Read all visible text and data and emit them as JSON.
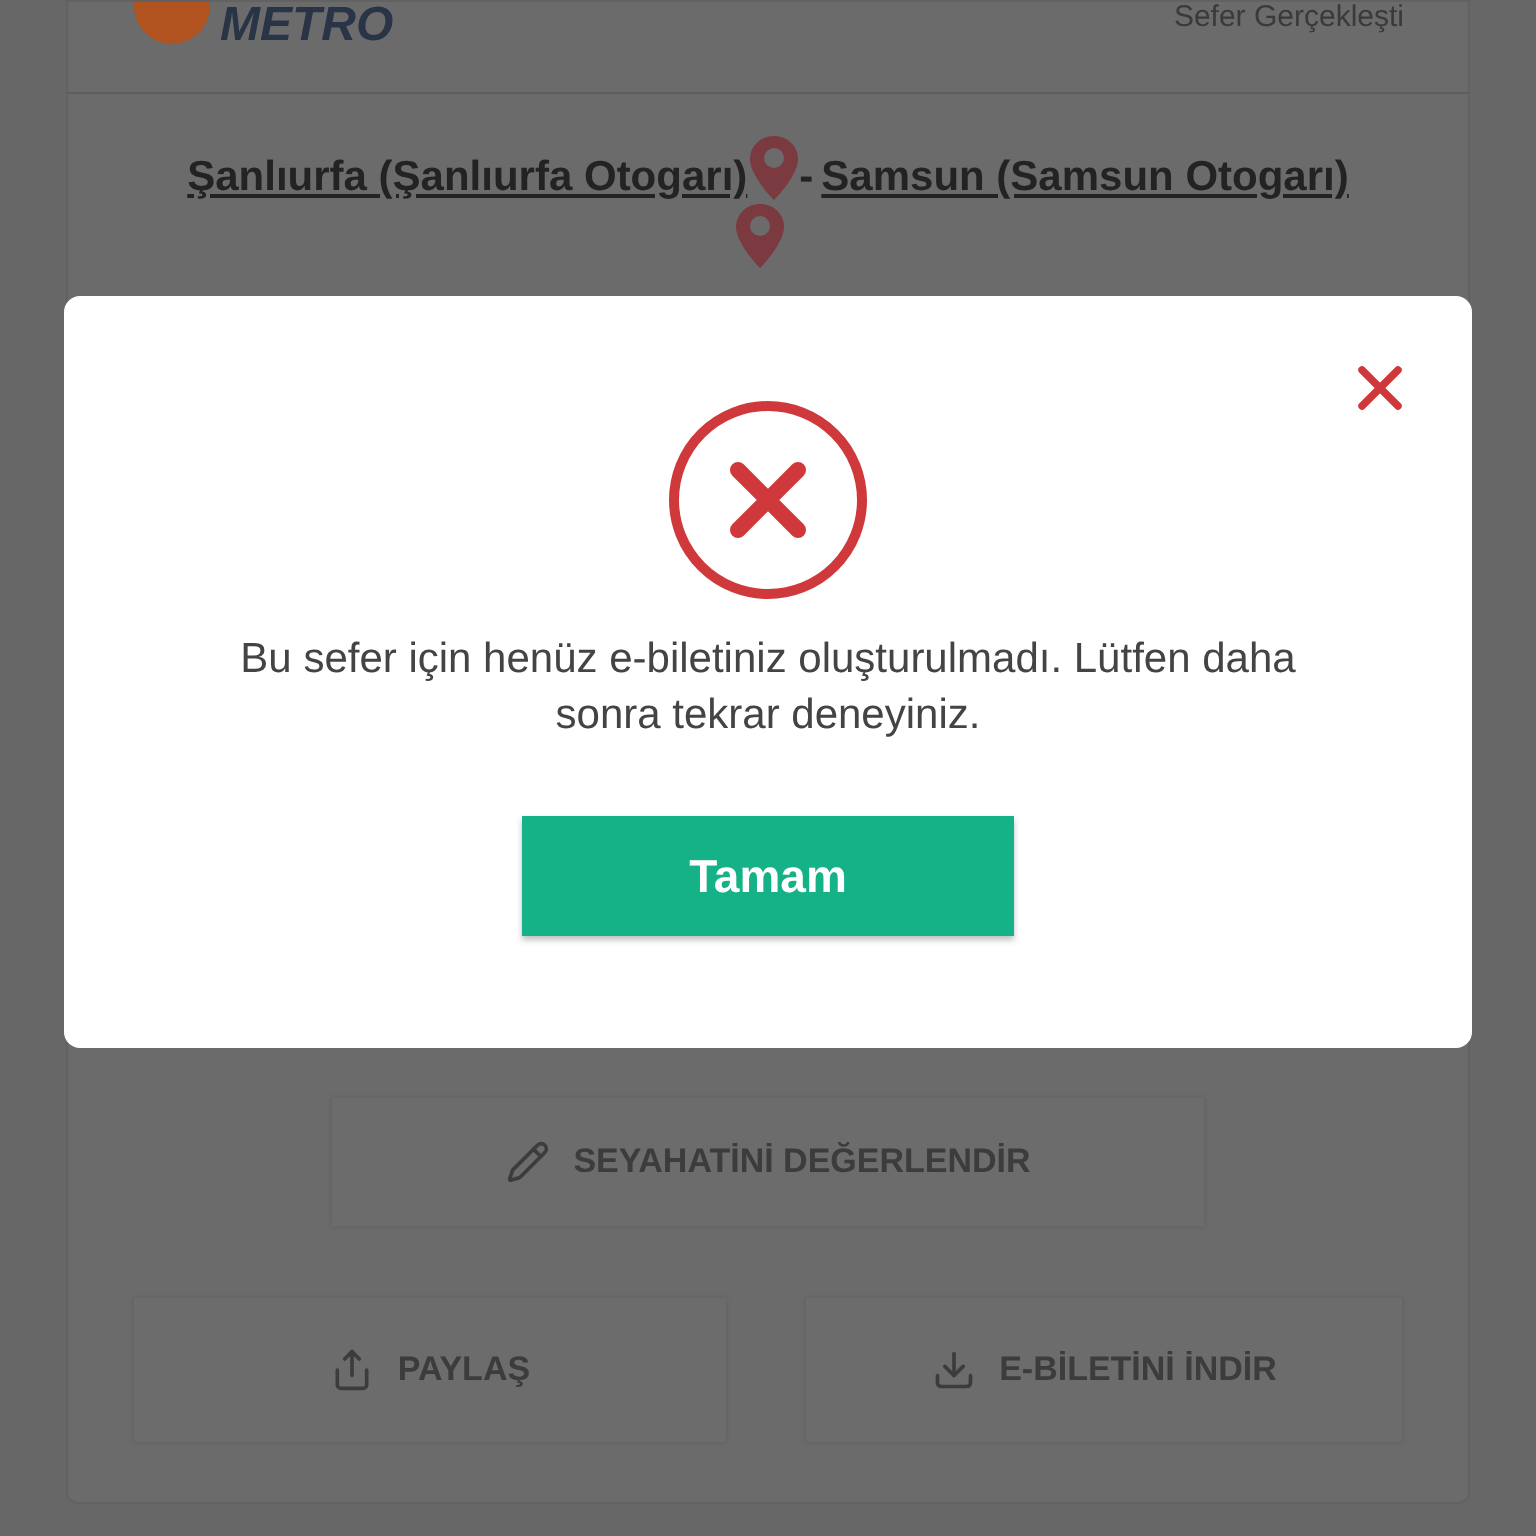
{
  "header": {
    "logo": "METRO",
    "status": "Sefer Gerçekleşti"
  },
  "route": {
    "from": "Şanlıurfa (Şanlıurfa Otogarı)",
    "separator": "-",
    "to": "Samsun (Samsun Otogarı)"
  },
  "actions": [
    {
      "kind": "rate",
      "label": "SEYAHATİNİ DEĞERLENDİR"
    },
    {
      "kind": "share",
      "label": "PAYLAŞ"
    },
    {
      "kind": "download",
      "label": "E-BİLETİNİ İNDİR"
    }
  ],
  "dialog": {
    "message": "Bu sefer için henüz e-biletiniz oluşturulmadı. Lütfen daha sonra tekrar deneyiniz.",
    "button": "Tamam"
  }
}
